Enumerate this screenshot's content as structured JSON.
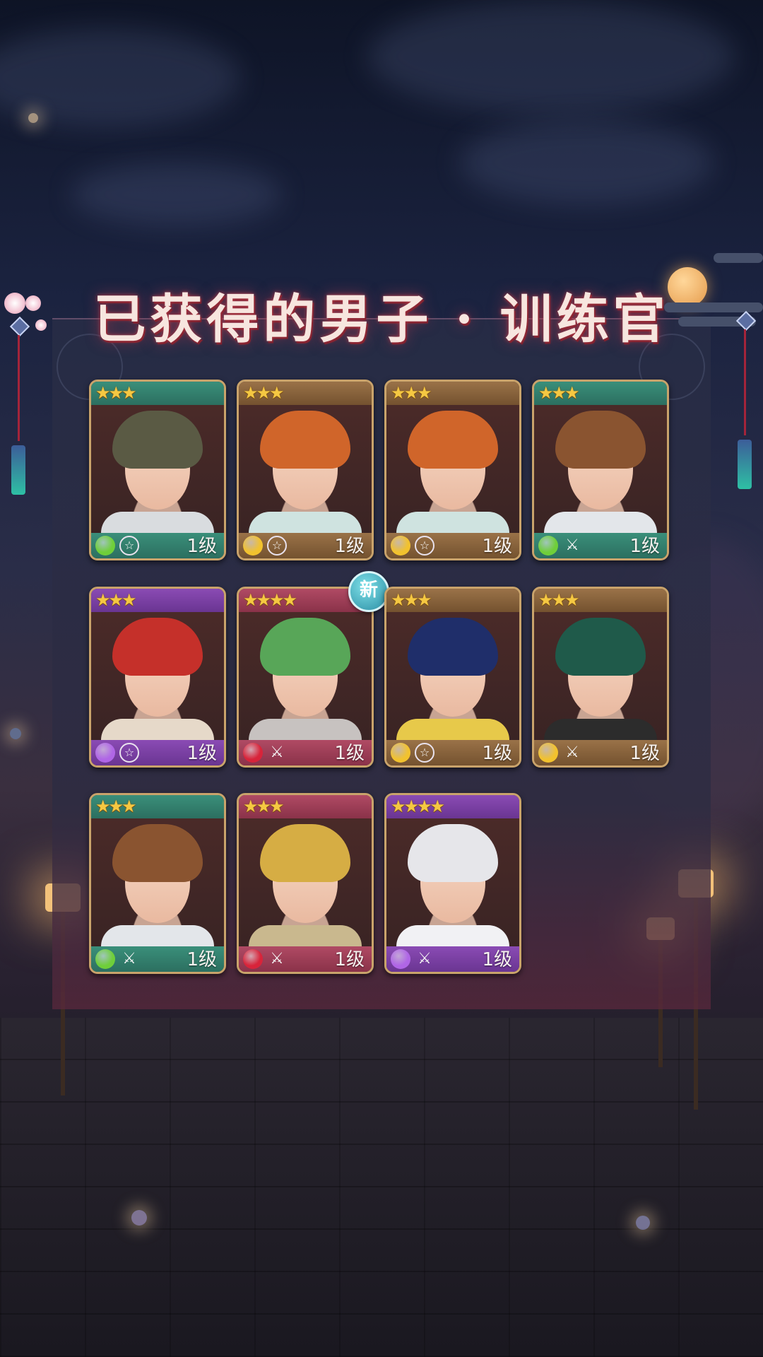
{
  "title": "已获得的男子 · 训练官",
  "cards": [
    {
      "stars": "★★★",
      "level": "1级",
      "element": "leaf",
      "class": "pentagram",
      "theme": "teal",
      "hair": "#5a5a44",
      "shirt": "#d9dcdf",
      "new": ""
    },
    {
      "stars": "★★★",
      "level": "1级",
      "element": "gem",
      "class": "pentagram",
      "theme": "bronze",
      "hair": "#d0652a",
      "shirt": "#cfe3e0",
      "new": ""
    },
    {
      "stars": "★★★",
      "level": "1级",
      "element": "gem",
      "class": "pentagram",
      "theme": "bronze",
      "hair": "#d0652a",
      "shirt": "#cfe3e0",
      "new": ""
    },
    {
      "stars": "★★★",
      "level": "1级",
      "element": "leaf",
      "class": "swords",
      "theme": "teal",
      "hair": "#8a5430",
      "shirt": "#e3e6ea",
      "new": ""
    },
    {
      "stars": "★★★",
      "level": "1级",
      "element": "crystal",
      "class": "pentagram",
      "theme": "purple",
      "hair": "#c5302a",
      "shirt": "#e6d9c9",
      "new": ""
    },
    {
      "stars": "★★★★",
      "level": "1级",
      "element": "flame",
      "class": "swords",
      "theme": "rose",
      "hair": "#58a658",
      "shirt": "#c7c2c0",
      "new": "新"
    },
    {
      "stars": "★★★",
      "level": "1级",
      "element": "gem",
      "class": "pentagram",
      "theme": "bronze",
      "hair": "#1f2e6a",
      "shirt": "#e7c94a",
      "new": ""
    },
    {
      "stars": "★★★",
      "level": "1级",
      "element": "gem",
      "class": "swords",
      "theme": "bronze",
      "hair": "#1f5a4a",
      "shirt": "#2c2c2c",
      "new": ""
    },
    {
      "stars": "★★★",
      "level": "1级",
      "element": "leaf",
      "class": "swords",
      "theme": "teal",
      "hair": "#8a5430",
      "shirt": "#e3e6ea",
      "new": ""
    },
    {
      "stars": "★★★",
      "level": "1级",
      "element": "flame",
      "class": "swords",
      "theme": "rose",
      "hair": "#d6ad44",
      "shirt": "#c9b88e",
      "new": ""
    },
    {
      "stars": "★★★★",
      "level": "1级",
      "element": "crystal",
      "class": "swords",
      "theme": "purple",
      "hair": "#e6e6ea",
      "shirt": "#f1f1f4",
      "new": ""
    }
  ],
  "colors": {
    "leaf": "#6fcf3a",
    "gem": "#f2c22e",
    "crystal": "#b066e6",
    "flame": "#d8243a"
  }
}
